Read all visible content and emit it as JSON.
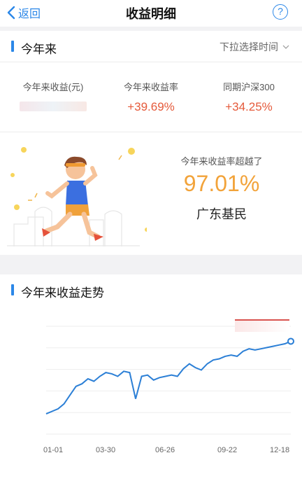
{
  "nav": {
    "back_label": "返回",
    "title": "收益明细",
    "help_icon": "question-circle-icon"
  },
  "section1": {
    "title": "今年来",
    "dropdown_label": "下拉选择时间"
  },
  "stats": [
    {
      "label": "今年来收益(元)",
      "value": ""
    },
    {
      "label": "今年来收益率",
      "value": "+39.69%"
    },
    {
      "label": "同期沪深300",
      "value": "+34.25%"
    }
  ],
  "rank": {
    "label": "今年来收益率超越了",
    "value": "97.01%",
    "who": "广东基民"
  },
  "section2": {
    "title": "今年来收益走势"
  },
  "chart_data": {
    "type": "line",
    "x_ticks": [
      "01-01",
      "03-30",
      "06-26",
      "09-22",
      "12-18"
    ],
    "series": [
      {
        "values": [
          0,
          2,
          4,
          8,
          15,
          22,
          24,
          28,
          26,
          30,
          33,
          32,
          30,
          34,
          33,
          12,
          30,
          31,
          27,
          29,
          30,
          31,
          30,
          36,
          40,
          37,
          35,
          40,
          43,
          44,
          46,
          47,
          46,
          50,
          52,
          51,
          52,
          53,
          54,
          55,
          56,
          58
        ]
      }
    ],
    "colors": {
      "line": "#2b7fd6"
    }
  }
}
